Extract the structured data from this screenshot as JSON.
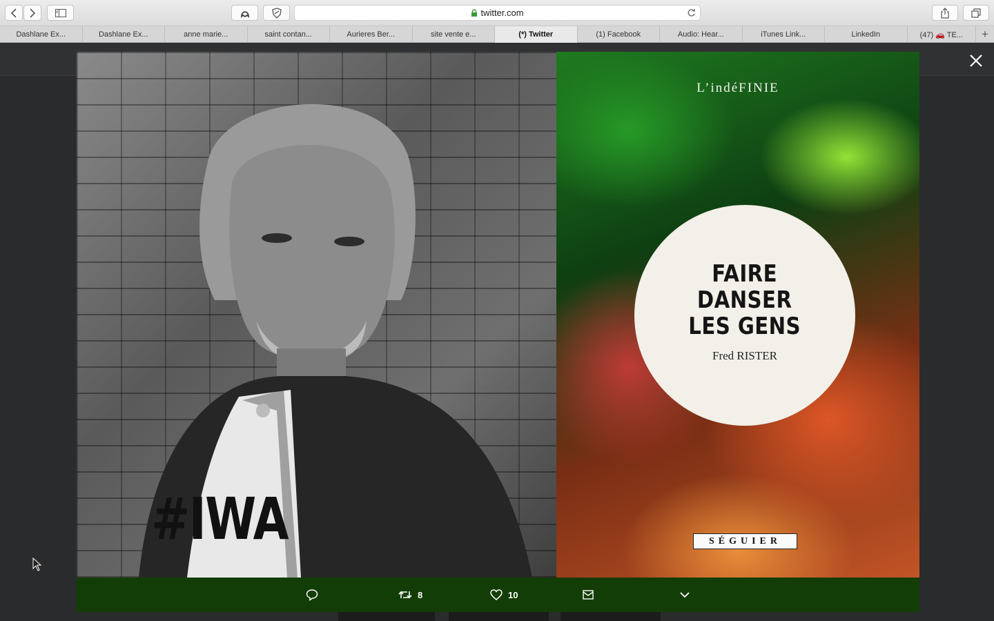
{
  "browser": {
    "url": "twitter.com",
    "tabs": [
      {
        "label": "Dashlane Ex...",
        "active": false
      },
      {
        "label": "Dashlane Ex...",
        "active": false
      },
      {
        "label": "anne marie...",
        "active": false
      },
      {
        "label": "saint contan...",
        "active": false
      },
      {
        "label": "Aurieres Ber...",
        "active": false
      },
      {
        "label": "site vente e...",
        "active": false
      },
      {
        "label": "(*) Twitter",
        "active": true
      },
      {
        "label": "(1) Facebook",
        "active": false
      },
      {
        "label": "Audio: Hear...",
        "active": false
      },
      {
        "label": "iTunes Link...",
        "active": false
      },
      {
        "label": "LinkedIn",
        "active": false
      },
      {
        "label": "(47) 🚗 TE...",
        "active": false
      }
    ],
    "new_tab_label": "+"
  },
  "cover": {
    "publisher_logo": "L’indéFINIE",
    "title_line1": "FAIRE",
    "title_line2": "DANSER",
    "title_line3": "LES GENS",
    "author": "Fred RISTER",
    "publisher": "SÉGUIER"
  },
  "actions": {
    "reply_count": "",
    "retweet_count": "8",
    "like_count": "10"
  },
  "photo_text": "#IWA"
}
